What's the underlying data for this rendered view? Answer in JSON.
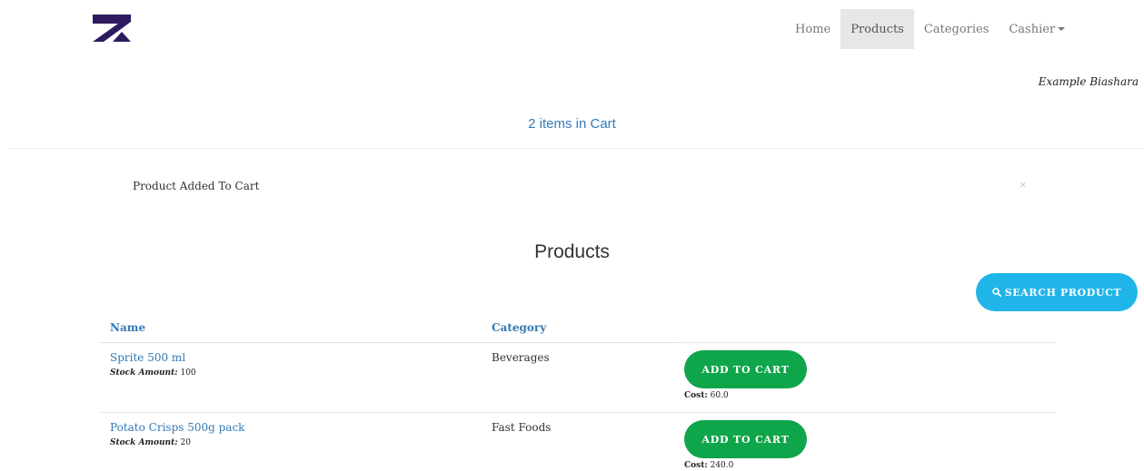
{
  "navbar": {
    "logo_icon": "z-logo-icon",
    "items": [
      {
        "label": "Home",
        "active": false
      },
      {
        "label": "Products",
        "active": true
      },
      {
        "label": "Categories",
        "active": false
      },
      {
        "label": "Cashier",
        "active": false
      }
    ]
  },
  "business_name": "Example Biashara",
  "cart": {
    "count_text": "2 items in Cart"
  },
  "alert": {
    "message": "Product Added To Cart",
    "close": "×"
  },
  "products": {
    "title": "Products",
    "search_button": "SEARCH PRODUCT",
    "search_icon": "search-icon",
    "columns": [
      "Name",
      "Category"
    ],
    "rows": [
      {
        "name": "Sprite 500 ml",
        "stock_label": "Stock Amount:",
        "stock_value": "100",
        "category": "Beverages",
        "button": "ADD TO CART",
        "cost_label": "Cost:",
        "cost_value": "60.0"
      },
      {
        "name": "Potato Crisps 500g pack",
        "stock_label": "Stock Amount:",
        "stock_value": "20",
        "category": "Fast Foods",
        "button": "ADD TO CART",
        "cost_label": "Cost:",
        "cost_value": "240.0"
      }
    ]
  },
  "colors": {
    "link": "#337ab7",
    "add_button": "#0fa54a",
    "search_button": "#1fb5e8",
    "logo": "#2e1a5e"
  }
}
